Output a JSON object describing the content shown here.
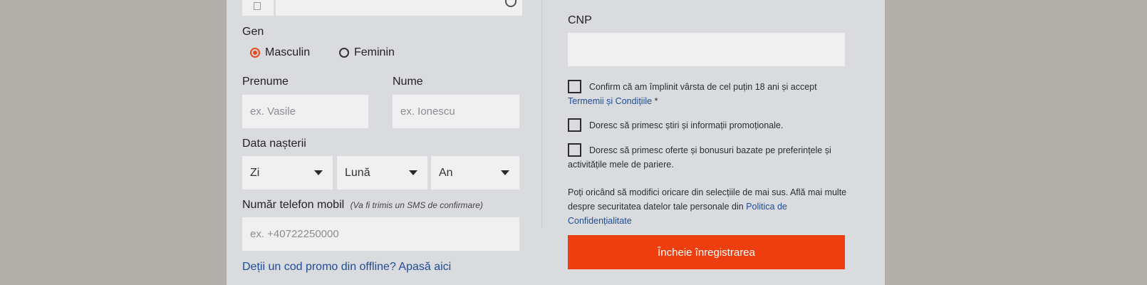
{
  "form": {
    "gender": {
      "label": "Gen",
      "options": [
        "Masculin",
        "Feminin"
      ],
      "selected": "Masculin"
    },
    "first_name": {
      "label": "Prenume",
      "placeholder": "ex. Vasile"
    },
    "last_name": {
      "label": "Nume",
      "placeholder": "ex. Ionescu"
    },
    "birth_date": {
      "label": "Data nașterii",
      "day": "Zi",
      "month": "Lună",
      "year": "An"
    },
    "phone": {
      "label": "Număr telefon mobil",
      "hint": "(Va fi trimis un SMS de confirmare)",
      "placeholder": "ex. +40722250000"
    },
    "promo_link": "Deții un cod promo din offline? Apasă aici",
    "cnp": {
      "label": "CNP",
      "value": ""
    },
    "consents": {
      "age": {
        "text": "Confirm că am împlinit vârsta de cel puțin 18 ani și accept",
        "link": "Termemii și Condițiile",
        "required": "*",
        "checked": false
      },
      "news": {
        "text": "Doresc să primesc știri și informații promoționale.",
        "checked": false
      },
      "offers": {
        "text": "Doresc să primesc oferte și bonusuri bazate pe preferințele și activitățile mele de pariere.",
        "checked": false
      }
    },
    "privacy_note": "Poți oricând să modifici oricare din selecțiile de mai sus. Află mai multe despre securitatea datelor tale personale din",
    "privacy_link": "Politica de Confidențialitate",
    "submit_label": "Încheie înregistrarea"
  },
  "colors": {
    "accent": "#ee3d0e",
    "link": "#1e4c96",
    "panel": "#d9dbde",
    "field": "#f0f0f1"
  }
}
